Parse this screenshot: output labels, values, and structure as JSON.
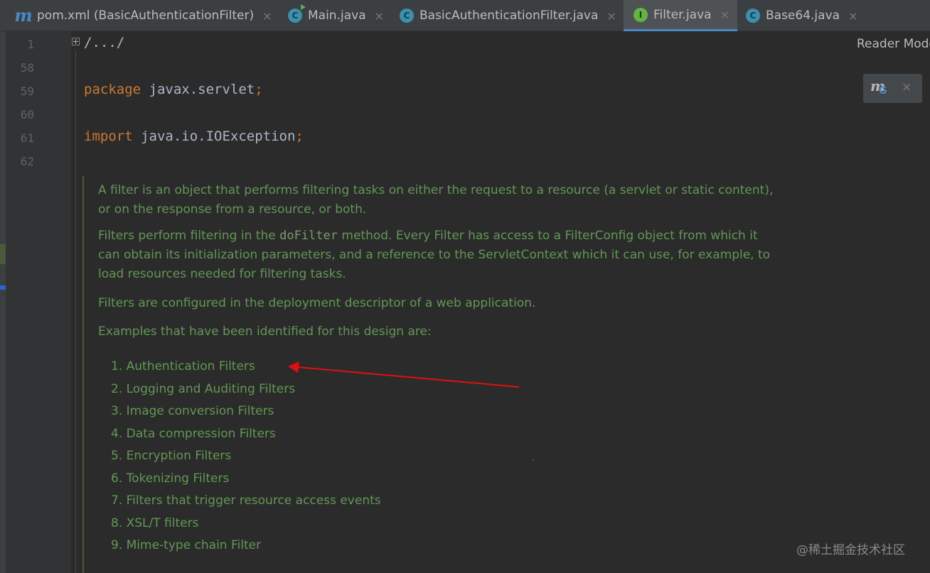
{
  "tabs": [
    {
      "label": "pom.xml (BasicAuthenticationFilter)",
      "icon": "maven-icon",
      "active": false
    },
    {
      "label": "Main.java",
      "icon": "runnable-class-icon",
      "active": false
    },
    {
      "label": "BasicAuthenticationFilter.java",
      "icon": "class-icon",
      "active": false
    },
    {
      "label": "Filter.java",
      "icon": "interface-icon",
      "active": true
    },
    {
      "label": "Base64.java",
      "icon": "class-icon",
      "active": false
    }
  ],
  "icon_letters": {
    "maven": "m",
    "class": "C",
    "interface": "I",
    "maven_g": "G"
  },
  "close_glyph": "×",
  "gutter": {
    "line_numbers": [
      "1",
      "58",
      "59",
      "60",
      "61",
      "62"
    ]
  },
  "code": {
    "line1": "/.../",
    "package_kw": "package",
    "package_name": " javax.servlet",
    "package_semicolon": ";",
    "import_kw": "import",
    "import_name": " java.io.IOException",
    "import_semicolon": ";"
  },
  "doc": {
    "p1": "A filter is an object that performs filtering tasks on either the request to a resource (a servlet or static content), or on the response from a resource, or both.",
    "p2_before": "Filters perform filtering in the ",
    "p2_code": "doFilter",
    "p2_after": " method. Every Filter has access to a FilterConfig object from which it can obtain its initialization parameters, and a reference to the ServletContext which it can use, for example, to load resources needed for filtering tasks.",
    "p3": "Filters are configured in the deployment descriptor of a web application.",
    "p4": "Examples that have been identified for this design are:",
    "list": [
      "1. Authentication Filters",
      "2. Logging and Auditing Filters",
      "3. Image conversion Filters",
      "4. Data compression Filters",
      "5. Encryption Filters",
      "6. Tokenizing Filters",
      "7. Filters that trigger resource access events",
      "8. XSL/T filters",
      "9. Mime-type chain Filter"
    ]
  },
  "reader_mode": "Reader Mode",
  "watermark": "@稀土掘金技术社区",
  "colors": {
    "background": "#2b2b2b",
    "tabbar": "#3c3f41",
    "active_tab": "#4e5254",
    "keyword": "#cc7832",
    "doc_text": "#629755",
    "annotation_arrow": "#e01010"
  }
}
